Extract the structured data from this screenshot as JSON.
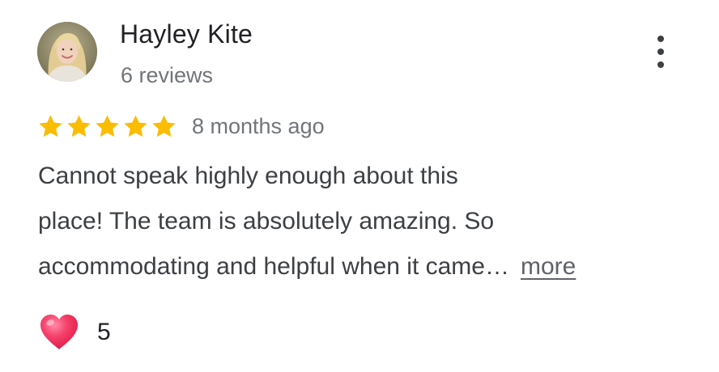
{
  "reviewer": {
    "name": "Hayley Kite",
    "meta": "6 reviews",
    "avatar_icon": "user-photo"
  },
  "menu": {
    "icon": "more-vertical-icon"
  },
  "review": {
    "rating": 5,
    "max_rating": 5,
    "star_color": "#fbbc04",
    "date": "8 months ago",
    "lines": [
      "Cannot speak highly enough about this",
      "place! The team is absolutely amazing. So",
      "accommodating and helpful when it came…"
    ],
    "more_label": "more"
  },
  "reactions": {
    "icon": "heart-icon",
    "count": "5",
    "heart_color": "#f2315d"
  }
}
